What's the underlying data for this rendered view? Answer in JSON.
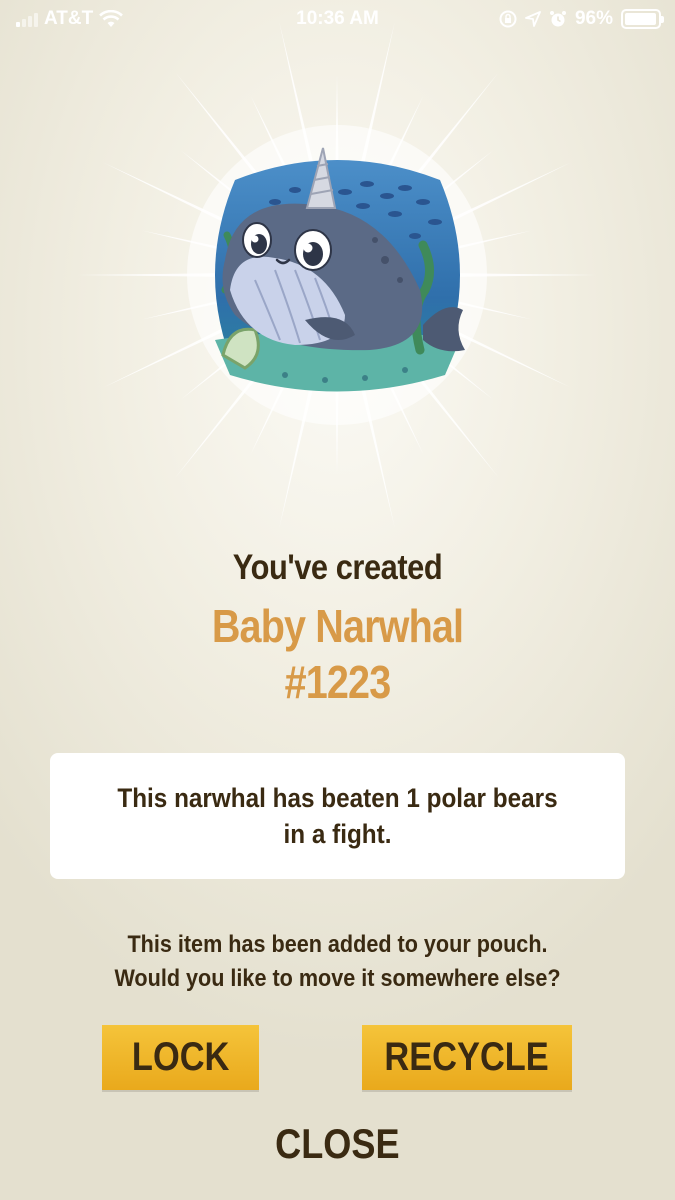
{
  "status_bar": {
    "carrier": "AT&T",
    "time": "10:36 AM",
    "battery_percent": "96%",
    "battery_level": 0.96,
    "signal_bars": 1,
    "icons": [
      "wifi-icon",
      "screen-lock-icon",
      "location-icon",
      "alarm-icon",
      "battery-icon"
    ]
  },
  "reward": {
    "heading": "You've created",
    "item_name": "Baby Narwhal",
    "item_number": "#1223",
    "description": "This narwhal has beaten 1 polar bears in a fight."
  },
  "pouch_message": {
    "line1": "This item has been added to your pouch.",
    "line2": "Would you like to move it somewhere else?"
  },
  "actions": {
    "lock_label": "LOCK",
    "recycle_label": "RECYCLE",
    "close_label": "CLOSE"
  },
  "colors": {
    "heading": "#3a2a12",
    "item_name": "#d89a48",
    "button": "#f2b92c",
    "background": "#f2efe3"
  }
}
